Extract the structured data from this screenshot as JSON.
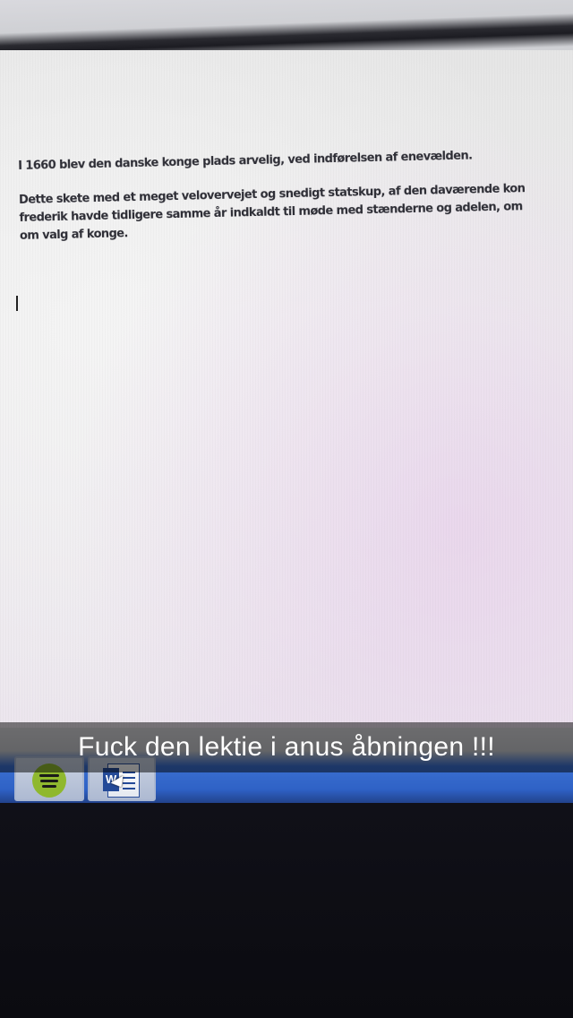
{
  "document": {
    "lines_para1": [
      "I 1660 blev den danske konge plads arvelig, ved indførelsen af enevælden."
    ],
    "lines_para2": [
      "Dette skete med et meget velovervejet og snedigt statskup, af den daværende kon",
      "frederik havde tidligere samme år indkaldt til møde med stænderne og adelen, om",
      "om valg af konge."
    ]
  },
  "caption": {
    "text": "Fuck den lektie i anus åbningen !!!"
  },
  "taskbar": {
    "apps": [
      {
        "name": "spotify-icon",
        "color": "#8fb82e"
      },
      {
        "name": "word-icon",
        "label": "W",
        "color": "#244a98"
      }
    ]
  }
}
